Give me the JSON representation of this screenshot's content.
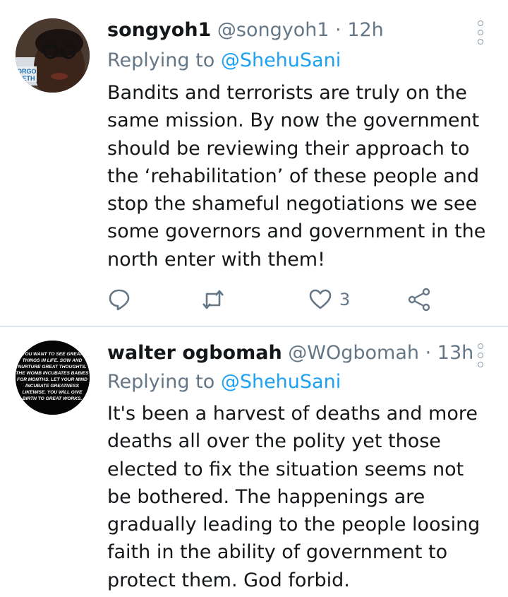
{
  "tweets": [
    {
      "name": "songyoh1",
      "handle": "@songyoh1",
      "separator": "·",
      "time": "12h",
      "replying_prefix": "Replying to",
      "replying_to": "@ShehuSani",
      "text": "Bandits and terrorists are truly on the same mission. By now the government should be reviewing their approach to the ‘rehabilitation’ of these people and stop the shameful negotiations we see some governors and government in the north enter with them!",
      "avatar_text": "ORGO METH",
      "actions": {
        "reply_icon": "reply-icon",
        "retweet_icon": "retweet-icon",
        "like_icon": "heart-icon",
        "like_count": "3",
        "share_icon": "share-icon"
      }
    },
    {
      "name": "walter ogbomah",
      "handle": "@WOgbomah",
      "separator": "·",
      "time": "13h",
      "replying_prefix": "Replying to",
      "replying_to": "@ShehuSani",
      "text": "It's been a harvest of deaths and more deaths all over the polity yet those elected to fix the situation seems not be bothered. The happenings are gradually leading to the people loosing faith in the ability of government to protect them. God forbid.",
      "avatar_text": "YOU WANT TO SEE GREAT THINGS IN LIFE. SOW AND NURTURE GREAT THOUGHTS. THE WOMB INCUBATES BABIES FOR MONTHS. LET YOUR MIND INCUBATE GREATNESS LIKEWISE. YOU WILL GIVE BIRTH TO GREAT WORKS."
    }
  ],
  "colors": {
    "accent": "#1da1f2",
    "muted": "#657786",
    "text": "#14171a"
  }
}
